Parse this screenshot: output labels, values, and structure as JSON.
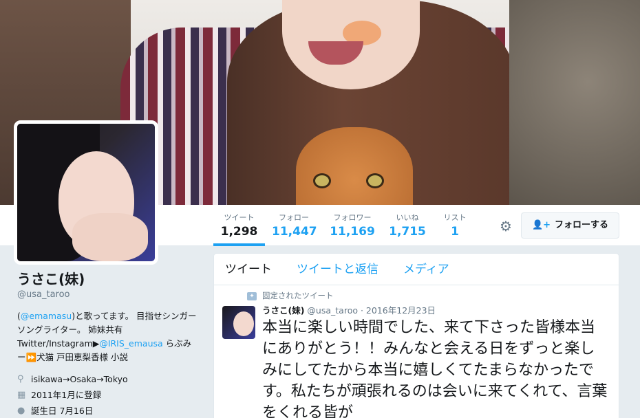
{
  "profile": {
    "name": "うさこ(妹)",
    "handle": "@usa_taroo",
    "bio": {
      "part1": "(",
      "link1": "@emamasu",
      "part2": ")と歌ってます。 目指せシンガーソングライター。 姉妹共有Twitter/Instagram▶",
      "link2": "@IRIS_emausa",
      "part3": " らぶみー⏩犬猫 戸田恵梨香様 小説"
    },
    "location": "isikawa→Osaka→Tokyo",
    "joined": "2011年1月に登録",
    "birthday": "誕生日 7月16日"
  },
  "stats": [
    {
      "label": "ツイート",
      "value": "1,298"
    },
    {
      "label": "フォロー",
      "value": "11,447"
    },
    {
      "label": "フォロワー",
      "value": "11,169"
    },
    {
      "label": "いいね",
      "value": "1,715"
    },
    {
      "label": "リスト",
      "value": "1"
    }
  ],
  "follow_button": "フォローする",
  "tabs": [
    "ツイート",
    "ツイートと返信",
    "メディア"
  ],
  "pinned_label": "固定されたツイート",
  "tweet": {
    "name": "うさこ(妹)",
    "handle": "@usa_taroo",
    "date": "· 2016年12月23日",
    "text": "本当に楽しい時間でした、来て下さった皆様本当にありがとう！！みんなと会える日をずっと楽しみにしてたから本当に嬉しくてたまらなかったです。私たちが頑張れるのは会いに来てくれて、言葉をくれる皆が"
  },
  "colors": {
    "accent": "#1da1f2",
    "text": "#14171a",
    "muted": "#657786",
    "background": "#e6ecf0"
  },
  "icons": [
    "gear-icon",
    "follow-person-icon",
    "location-icon",
    "calendar-icon",
    "balloon-icon",
    "pin-icon"
  ]
}
